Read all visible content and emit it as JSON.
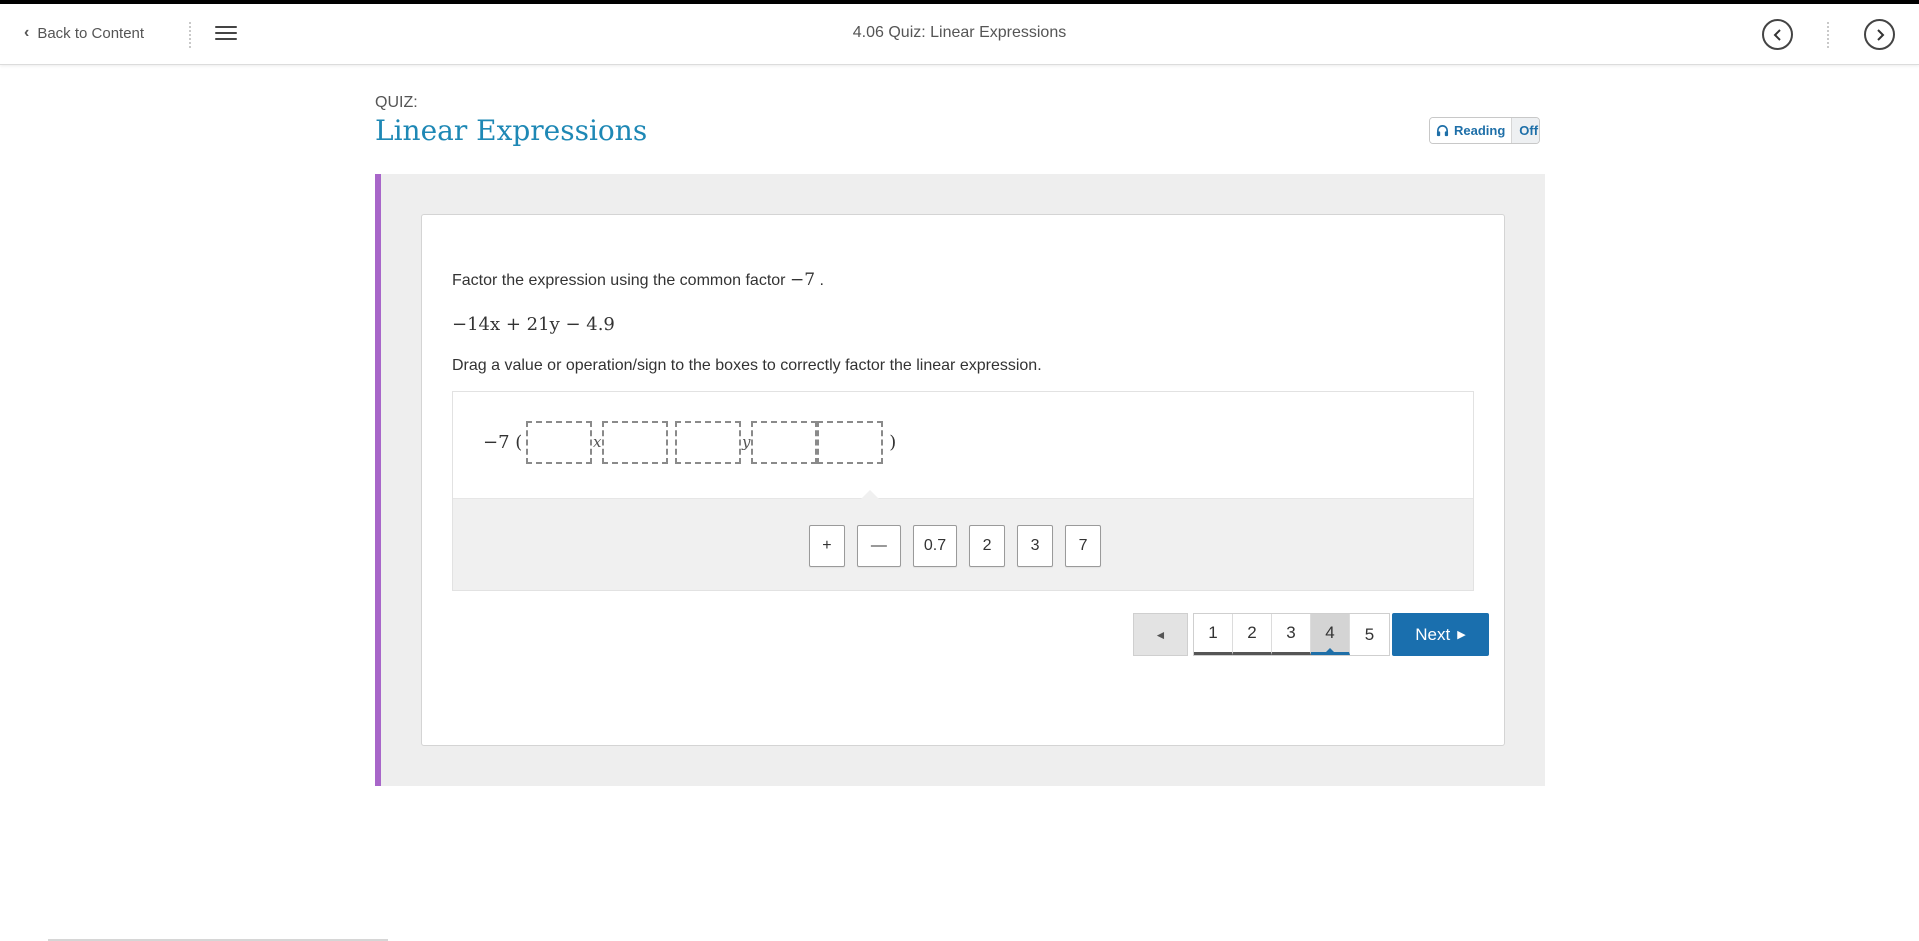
{
  "topbar": {
    "back_label": "Back to Content",
    "title": "4.06 Quiz: Linear Expressions"
  },
  "quiz": {
    "label": "QUIZ:",
    "title": "Linear Expressions"
  },
  "reading": {
    "label": "Reading",
    "state": "Off"
  },
  "question": {
    "prompt": "Factor the expression using the common factor",
    "factor": "−7",
    "prompt_end": ".",
    "expression": "−14x + 21y − 4.9",
    "instructions": "Drag a value or operation/sign to the boxes to correctly factor the linear expression.",
    "answer_prefix": "−7 (",
    "answer_suffix": ")",
    "var_x": "x",
    "var_y": "y"
  },
  "tiles": [
    "+",
    "—",
    "0.7",
    "2",
    "3",
    "7"
  ],
  "pagination": {
    "prev_label": "◄",
    "pages": [
      "1",
      "2",
      "3",
      "4",
      "5"
    ],
    "current": "4",
    "next_label": "Next"
  },
  "colors": {
    "accent": "#1e88b5",
    "next_button": "#1a6fae",
    "quiz_bar": "#a866c9"
  }
}
